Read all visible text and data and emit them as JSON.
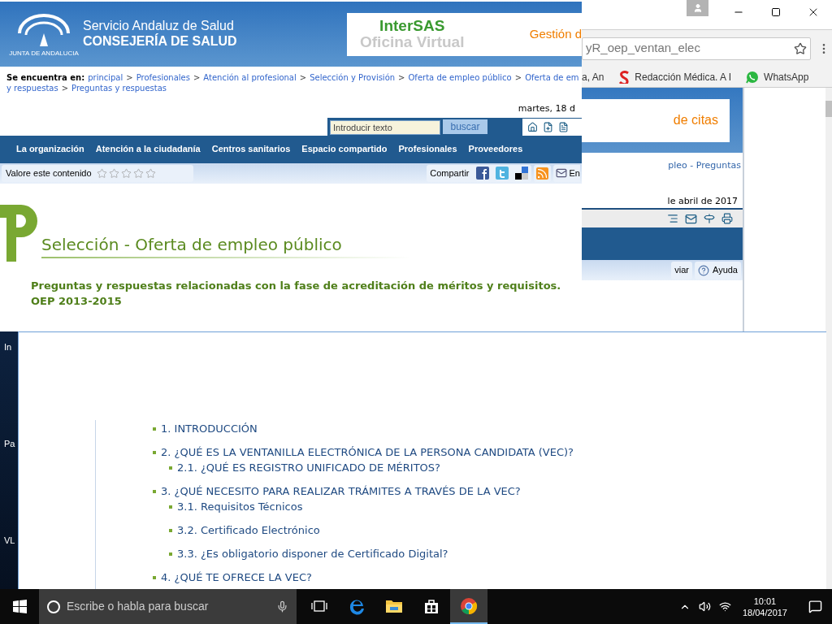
{
  "desktop": {
    "icons": [
      {
        "label": "In"
      },
      {
        "label": "Pa"
      },
      {
        "label": "VL"
      }
    ]
  },
  "browser": {
    "address": "yR_oep_ventan_elec",
    "bookmarks": [
      {
        "kind": "plain",
        "label": "a, An"
      },
      {
        "kind": "news",
        "label": "Redacción Médica. A I"
      },
      {
        "kind": "chat",
        "label": "WhatsApp"
      }
    ],
    "behind_page": {
      "banner": "de citas",
      "breadcrumb": "pleo - Preguntas",
      "date": "le abril de 2017",
      "buttons": [
        {
          "kind": "plain",
          "label": "viar"
        },
        {
          "kind": "help",
          "label": "Ayuda"
        }
      ]
    }
  },
  "page": {
    "header": {
      "logo_text": "JUNTA DE ANDALUCIA",
      "org_line1": "Servicio Andaluz de Salud",
      "org_line2": "CONSEJERÍA DE SALUD",
      "banner_title": "InterSAS",
      "banner_subtitle": "Oficina Virtual",
      "banner_extra": "Gestión d"
    },
    "breadcrumb": {
      "label": "Se encuentra en:",
      "separator": ">",
      "lines": [
        [
          "principal",
          "Profesionales",
          "Atención al profesional",
          "Selección y Provisión",
          "Oferta de empleo público",
          "Oferta de em"
        ],
        [
          "y respuestas",
          "Preguntas y respuestas"
        ]
      ]
    },
    "date": "martes, 18 d",
    "search": {
      "placeholder": "Introducir texto",
      "button": "buscar"
    },
    "nav": [
      "La organización",
      "Atención a la ciudadanía",
      "Centros sanitarios",
      "Espacio compartido",
      "Profesionales",
      "Proveedores"
    ],
    "rating": {
      "label": "Valore este contenido",
      "stars": 0
    },
    "share": {
      "label": "Compartir",
      "send": "En"
    },
    "title": "Selección - Oferta de empleo público",
    "subtitle": "Preguntas y respuestas relacionadas con la fase de acreditación de méritos y requisitos. OEP 2013-2015",
    "toc": [
      {
        "number": "1.",
        "text": "INTRODUCCIÓN"
      },
      {
        "number": "2.",
        "text": "¿QUÉ ES LA VENTANILLA ELECTRÓNICA DE LA PERSONA CANDIDATA (VEC)?",
        "children": [
          {
            "number": "2.1.",
            "text": "¿QUÉ ES REGISTRO UNIFICADO DE MÉRITOS?"
          }
        ]
      },
      {
        "number": "3.",
        "text": "¿QUÉ NECESITO PARA REALIZAR TRÁMITES A TRAVÉS DE LA VEC?",
        "children": [
          {
            "number": "3.1.",
            "text": "Requisitos Técnicos"
          },
          {
            "number": "3.2.",
            "text": "Certificado Electrónico"
          },
          {
            "number": "3.3.",
            "text": "¿Es obligatorio disponer de Certificado Digital?"
          }
        ]
      },
      {
        "number": "4.",
        "text": "¿QUÉ TE OFRECE LA VEC?"
      }
    ]
  },
  "taskbar": {
    "search_placeholder": "Escribe o habla para buscar",
    "apps": [
      {
        "kind": "taskview",
        "selected": false
      },
      {
        "kind": "edge",
        "selected": false
      },
      {
        "kind": "folder",
        "selected": false
      },
      {
        "kind": "store",
        "selected": false
      },
      {
        "kind": "chrome",
        "selected": true
      }
    ],
    "time": "10:01",
    "date": "18/04/2017"
  }
}
